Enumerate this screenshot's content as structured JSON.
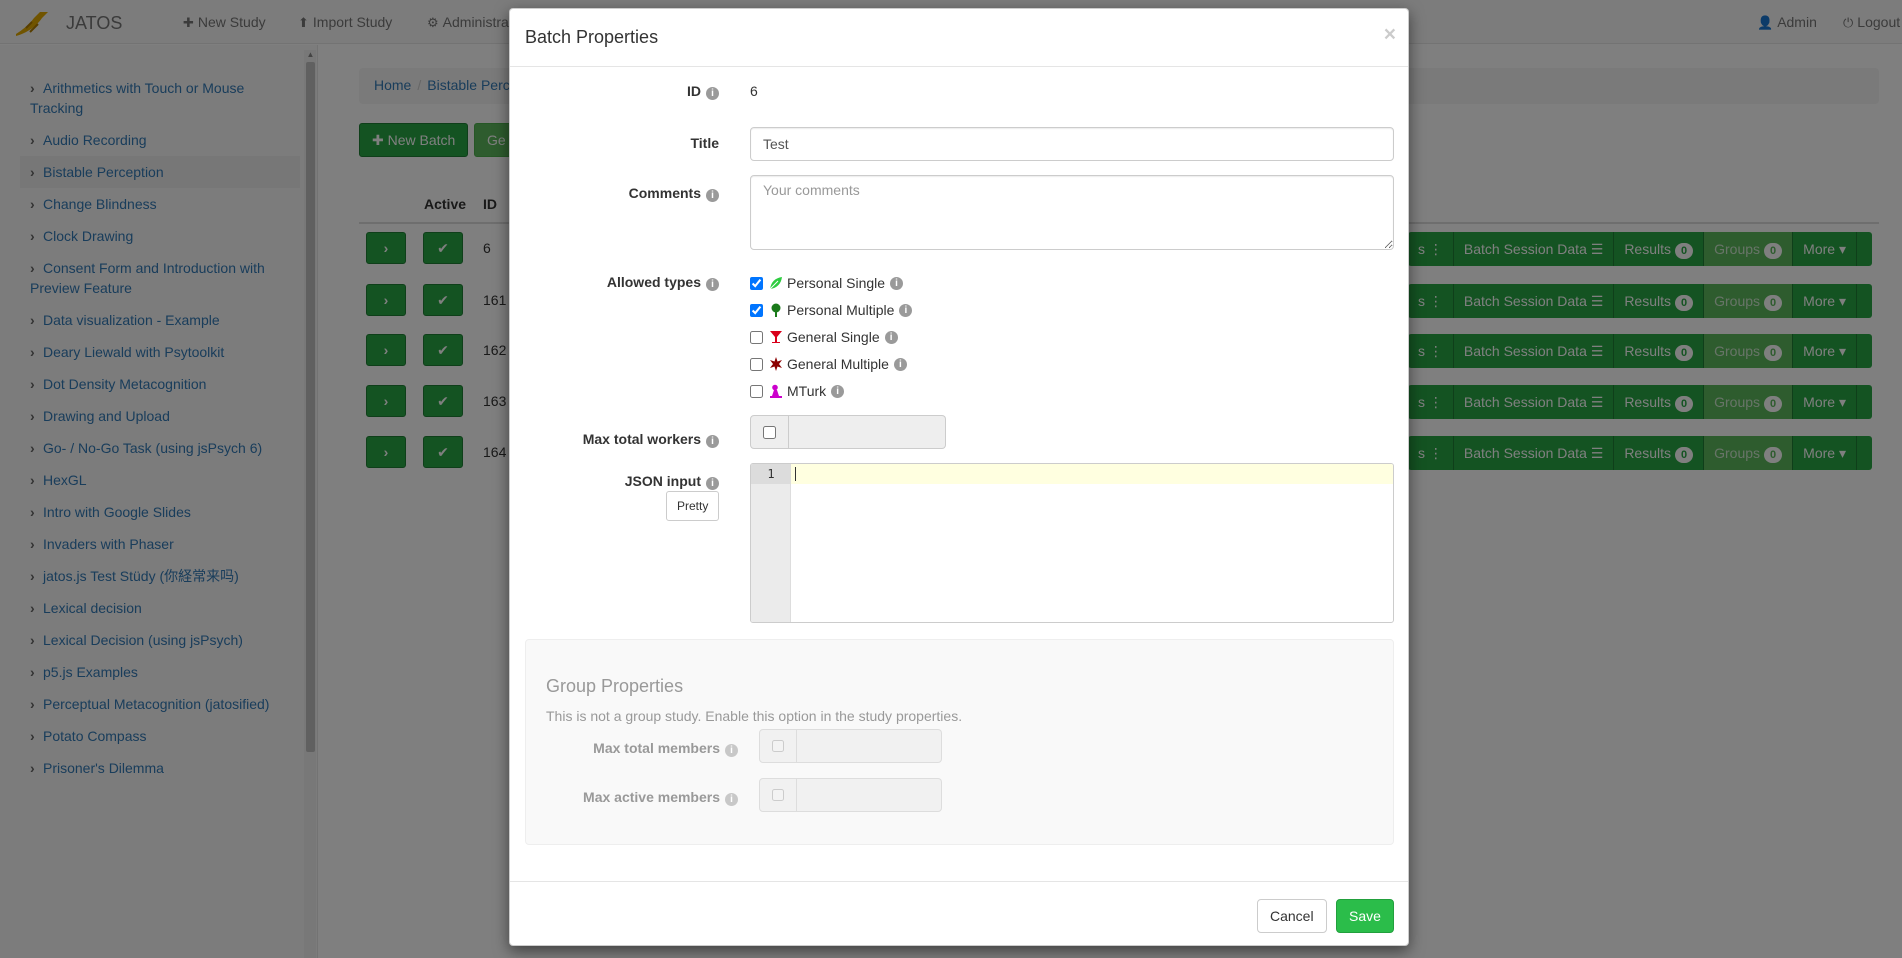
{
  "navbar": {
    "brand": "JATOS",
    "new_study": "New Study",
    "import_study": "Import Study",
    "administration": "Administra",
    "admin": "Admin",
    "logout": "Logout"
  },
  "sidebar": {
    "items": [
      {
        "label": "Arithmetics with Touch or Mouse Tracking"
      },
      {
        "label": "Audio Recording"
      },
      {
        "label": "Bistable Perception"
      },
      {
        "label": "Change Blindness"
      },
      {
        "label": "Clock Drawing"
      },
      {
        "label": "Consent Form and Introduction with Preview Feature"
      },
      {
        "label": "Data visualization - Example"
      },
      {
        "label": "Deary Liewald with Psytoolkit"
      },
      {
        "label": "Dot Density Metacognition"
      },
      {
        "label": "Drawing and Upload"
      },
      {
        "label": "Go- / No-Go Task (using jsPsych 6)"
      },
      {
        "label": "HexGL"
      },
      {
        "label": "Intro with Google Slides"
      },
      {
        "label": "Invaders with Phaser"
      },
      {
        "label": "jatos.js Test Stüdy (你経常来吗)"
      },
      {
        "label": "Lexical decision"
      },
      {
        "label": "Lexical Decision (using jsPsych)"
      },
      {
        "label": "p5.js Examples"
      },
      {
        "label": "Perceptual Metacognition (jatosified)"
      },
      {
        "label": "Potato Compass"
      },
      {
        "label": "Prisoner's Dilemma"
      }
    ]
  },
  "breadcrumb": {
    "home": "Home",
    "current": "Bistable Perc"
  },
  "toolbar": {
    "new_batch": "New Batch",
    "second_button": "Ge"
  },
  "table": {
    "headers": {
      "active": "Active",
      "id": "ID"
    },
    "rows": [
      {
        "id": "6"
      },
      {
        "id": "161"
      },
      {
        "id": "162"
      },
      {
        "id": "163"
      },
      {
        "id": "164"
      }
    ],
    "actions": {
      "workers_tail": "s",
      "batch_session_data": "Batch Session Data",
      "results": "Results",
      "results_count": "0",
      "groups": "Groups",
      "groups_count": "0",
      "more": "More"
    }
  },
  "modal": {
    "title": "Batch Properties",
    "close": "×",
    "id_label": "ID",
    "id_value": "6",
    "title_label": "Title",
    "title_value": "Test",
    "comments_label": "Comments",
    "comments_placeholder": "Your comments",
    "allowed_types_label": "Allowed types",
    "types": [
      {
        "label": "Personal Single",
        "checked": true,
        "color": "#2ecc40"
      },
      {
        "label": "Personal Multiple",
        "checked": true,
        "color": "#1a7a1a"
      },
      {
        "label": "General Single",
        "checked": false,
        "color": "#d9001b"
      },
      {
        "label": "General Multiple",
        "checked": false,
        "color": "#8b0000"
      },
      {
        "label": "MTurk",
        "checked": false,
        "color": "#cc00cc"
      }
    ],
    "max_workers_label": "Max total workers",
    "json_label": "JSON input",
    "pretty_button": "Pretty",
    "line_number": "1",
    "group": {
      "title": "Group Properties",
      "note": "This is not a group study. Enable this option in the study properties.",
      "max_total_members": "Max total members",
      "max_active_members": "Max active members"
    },
    "cancel": "Cancel",
    "save": "Save"
  },
  "colors": {
    "accent_green": "#28a745",
    "link_blue": "#337ab7",
    "save_green": "#2bbd4a"
  }
}
